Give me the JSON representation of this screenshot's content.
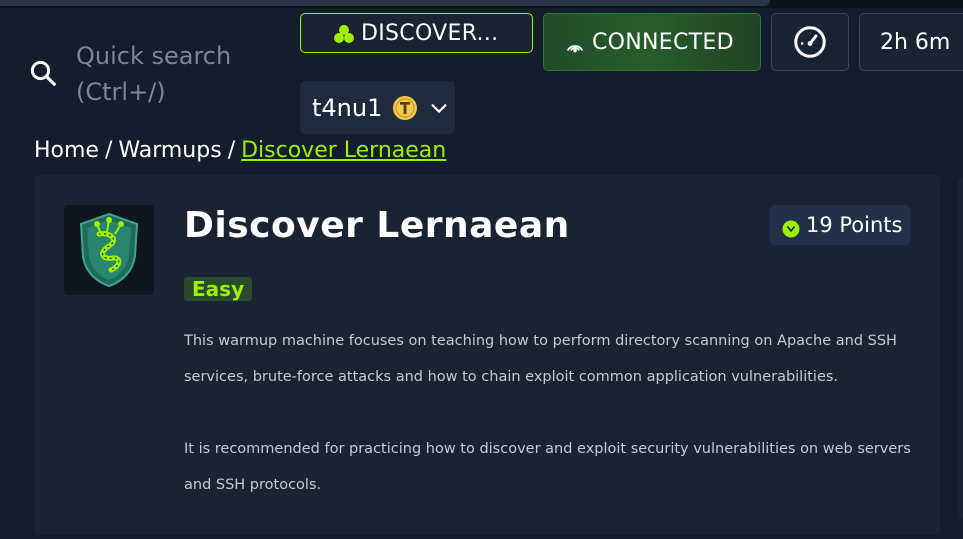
{
  "search": {
    "placeholder": "Quick search (Ctrl+/)"
  },
  "header": {
    "discover_label": "DISCOVER...",
    "connection_status": "CONNECTED",
    "timer": "2h 6m",
    "username": "t4nu1"
  },
  "breadcrumb": {
    "home": "Home",
    "section": "Warmups",
    "current": "Discover Lernaean",
    "separator": "/"
  },
  "machine": {
    "title": "Discover Lernaean",
    "points": "19 Points",
    "difficulty": "Easy",
    "description": [
      "This warmup machine focuses on teaching how to perform directory scanning on Apache and SSH services, brute-force attacks and how to chain exploit common application vulnerabilities.",
      "It is recommended for practicing how to discover and exploit security vulnerabilities on web servers and SSH protocols."
    ]
  },
  "colors": {
    "accent": "#9fef00",
    "background": "#141d2b",
    "card": "#1a2332",
    "connected_green": "#275c2c",
    "coin_yellow": "#f2c94c"
  },
  "icons": [
    "search-icon",
    "users-icon",
    "signal-icon",
    "speedometer-icon",
    "coin-icon",
    "chevron-down-icon",
    "machine-logo",
    "points-icon"
  ]
}
